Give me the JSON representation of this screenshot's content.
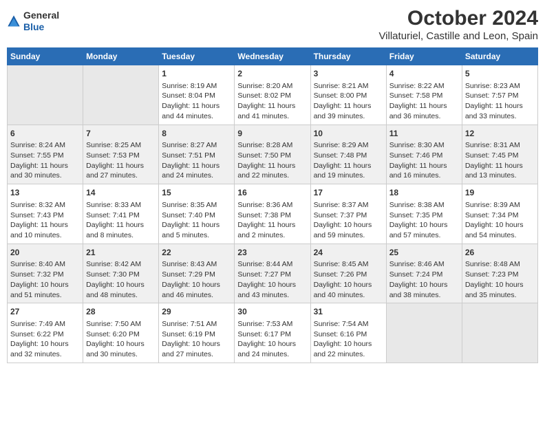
{
  "header": {
    "logo_general": "General",
    "logo_blue": "Blue",
    "title": "October 2024",
    "subtitle": "Villaturiel, Castille and Leon, Spain"
  },
  "weekdays": [
    "Sunday",
    "Monday",
    "Tuesday",
    "Wednesday",
    "Thursday",
    "Friday",
    "Saturday"
  ],
  "weeks": [
    [
      {
        "day": "",
        "content": ""
      },
      {
        "day": "",
        "content": ""
      },
      {
        "day": "1",
        "content": "Sunrise: 8:19 AM\nSunset: 8:04 PM\nDaylight: 11 hours and 44 minutes."
      },
      {
        "day": "2",
        "content": "Sunrise: 8:20 AM\nSunset: 8:02 PM\nDaylight: 11 hours and 41 minutes."
      },
      {
        "day": "3",
        "content": "Sunrise: 8:21 AM\nSunset: 8:00 PM\nDaylight: 11 hours and 39 minutes."
      },
      {
        "day": "4",
        "content": "Sunrise: 8:22 AM\nSunset: 7:58 PM\nDaylight: 11 hours and 36 minutes."
      },
      {
        "day": "5",
        "content": "Sunrise: 8:23 AM\nSunset: 7:57 PM\nDaylight: 11 hours and 33 minutes."
      }
    ],
    [
      {
        "day": "6",
        "content": "Sunrise: 8:24 AM\nSunset: 7:55 PM\nDaylight: 11 hours and 30 minutes."
      },
      {
        "day": "7",
        "content": "Sunrise: 8:25 AM\nSunset: 7:53 PM\nDaylight: 11 hours and 27 minutes."
      },
      {
        "day": "8",
        "content": "Sunrise: 8:27 AM\nSunset: 7:51 PM\nDaylight: 11 hours and 24 minutes."
      },
      {
        "day": "9",
        "content": "Sunrise: 8:28 AM\nSunset: 7:50 PM\nDaylight: 11 hours and 22 minutes."
      },
      {
        "day": "10",
        "content": "Sunrise: 8:29 AM\nSunset: 7:48 PM\nDaylight: 11 hours and 19 minutes."
      },
      {
        "day": "11",
        "content": "Sunrise: 8:30 AM\nSunset: 7:46 PM\nDaylight: 11 hours and 16 minutes."
      },
      {
        "day": "12",
        "content": "Sunrise: 8:31 AM\nSunset: 7:45 PM\nDaylight: 11 hours and 13 minutes."
      }
    ],
    [
      {
        "day": "13",
        "content": "Sunrise: 8:32 AM\nSunset: 7:43 PM\nDaylight: 11 hours and 10 minutes."
      },
      {
        "day": "14",
        "content": "Sunrise: 8:33 AM\nSunset: 7:41 PM\nDaylight: 11 hours and 8 minutes."
      },
      {
        "day": "15",
        "content": "Sunrise: 8:35 AM\nSunset: 7:40 PM\nDaylight: 11 hours and 5 minutes."
      },
      {
        "day": "16",
        "content": "Sunrise: 8:36 AM\nSunset: 7:38 PM\nDaylight: 11 hours and 2 minutes."
      },
      {
        "day": "17",
        "content": "Sunrise: 8:37 AM\nSunset: 7:37 PM\nDaylight: 10 hours and 59 minutes."
      },
      {
        "day": "18",
        "content": "Sunrise: 8:38 AM\nSunset: 7:35 PM\nDaylight: 10 hours and 57 minutes."
      },
      {
        "day": "19",
        "content": "Sunrise: 8:39 AM\nSunset: 7:34 PM\nDaylight: 10 hours and 54 minutes."
      }
    ],
    [
      {
        "day": "20",
        "content": "Sunrise: 8:40 AM\nSunset: 7:32 PM\nDaylight: 10 hours and 51 minutes."
      },
      {
        "day": "21",
        "content": "Sunrise: 8:42 AM\nSunset: 7:30 PM\nDaylight: 10 hours and 48 minutes."
      },
      {
        "day": "22",
        "content": "Sunrise: 8:43 AM\nSunset: 7:29 PM\nDaylight: 10 hours and 46 minutes."
      },
      {
        "day": "23",
        "content": "Sunrise: 8:44 AM\nSunset: 7:27 PM\nDaylight: 10 hours and 43 minutes."
      },
      {
        "day": "24",
        "content": "Sunrise: 8:45 AM\nSunset: 7:26 PM\nDaylight: 10 hours and 40 minutes."
      },
      {
        "day": "25",
        "content": "Sunrise: 8:46 AM\nSunset: 7:24 PM\nDaylight: 10 hours and 38 minutes."
      },
      {
        "day": "26",
        "content": "Sunrise: 8:48 AM\nSunset: 7:23 PM\nDaylight: 10 hours and 35 minutes."
      }
    ],
    [
      {
        "day": "27",
        "content": "Sunrise: 7:49 AM\nSunset: 6:22 PM\nDaylight: 10 hours and 32 minutes."
      },
      {
        "day": "28",
        "content": "Sunrise: 7:50 AM\nSunset: 6:20 PM\nDaylight: 10 hours and 30 minutes."
      },
      {
        "day": "29",
        "content": "Sunrise: 7:51 AM\nSunset: 6:19 PM\nDaylight: 10 hours and 27 minutes."
      },
      {
        "day": "30",
        "content": "Sunrise: 7:53 AM\nSunset: 6:17 PM\nDaylight: 10 hours and 24 minutes."
      },
      {
        "day": "31",
        "content": "Sunrise: 7:54 AM\nSunset: 6:16 PM\nDaylight: 10 hours and 22 minutes."
      },
      {
        "day": "",
        "content": ""
      },
      {
        "day": "",
        "content": ""
      }
    ]
  ]
}
